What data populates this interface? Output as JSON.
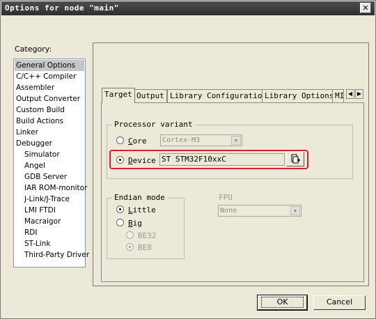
{
  "window": {
    "title": "Options for node \"main\"",
    "close_glyph": "✕"
  },
  "category": {
    "label": "Category:",
    "items": [
      {
        "label": "General Options",
        "selected": true,
        "indent": false
      },
      {
        "label": "C/C++ Compiler",
        "indent": false
      },
      {
        "label": "Assembler",
        "indent": false
      },
      {
        "label": "Output Converter",
        "indent": false
      },
      {
        "label": "Custom Build",
        "indent": false
      },
      {
        "label": "Build Actions",
        "indent": false
      },
      {
        "label": "Linker",
        "indent": false
      },
      {
        "label": "Debugger",
        "indent": false
      },
      {
        "label": "Simulator",
        "indent": true
      },
      {
        "label": "Angel",
        "indent": true
      },
      {
        "label": "GDB Server",
        "indent": true
      },
      {
        "label": "IAR ROM-monitor",
        "indent": true
      },
      {
        "label": "J-Link/J-Trace",
        "indent": true
      },
      {
        "label": "LMI FTDI",
        "indent": true
      },
      {
        "label": "Macraigor",
        "indent": true
      },
      {
        "label": "RDI",
        "indent": true
      },
      {
        "label": "ST-Link",
        "indent": true
      },
      {
        "label": "Third-Party Driver",
        "indent": true
      }
    ]
  },
  "tabs": [
    {
      "label": "Target",
      "active": true
    },
    {
      "label": "Output"
    },
    {
      "label": "Library Configuration"
    },
    {
      "label": "Library Options"
    },
    {
      "label": "MI"
    }
  ],
  "tab_scroll": {
    "left": "◀",
    "right": "▶"
  },
  "processor_variant": {
    "title": "Processor variant",
    "core_label_u": "C",
    "core_label_rest": "ore",
    "core_value": "Cortex-M3",
    "device_label_u": "D",
    "device_label_rest": "evice",
    "device_value": "ST STM32F10xxC",
    "selected": "device"
  },
  "endian": {
    "title": "Endian mode",
    "little_u": "L",
    "little_rest": "ittle",
    "big_u": "B",
    "big_rest": "ig",
    "be32": "BE32",
    "be8": "BE8",
    "selected": "little"
  },
  "fpu": {
    "title": "FPU",
    "value": "None"
  },
  "buttons": {
    "ok": "OK",
    "cancel": "Cancel"
  },
  "highlight_color": "#d8232a"
}
